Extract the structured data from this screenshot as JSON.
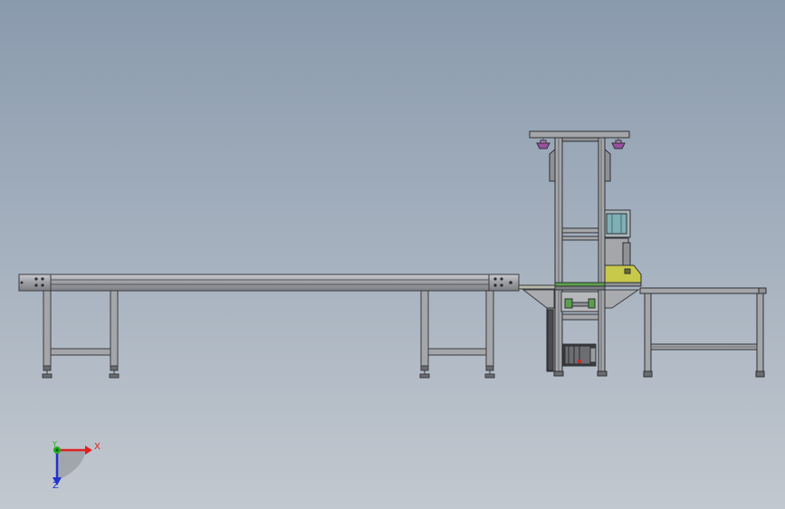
{
  "viewport": {
    "background_top": "#8a9aad",
    "background_bottom": "#c2c8cf"
  },
  "model": {
    "frame_color": "#8a8c90",
    "frame_dark": "#3a3c40",
    "belt_color": "#5aa04c",
    "accent_color": "#c8c84a",
    "gripper_color": "#a050a8",
    "panel_color": "#7fb0b8"
  },
  "triad": {
    "x_label": "X",
    "y_label": "Y",
    "z_label": "Z",
    "x_color": "#e02020",
    "y_color": "#20b020",
    "z_color": "#2030d0"
  }
}
